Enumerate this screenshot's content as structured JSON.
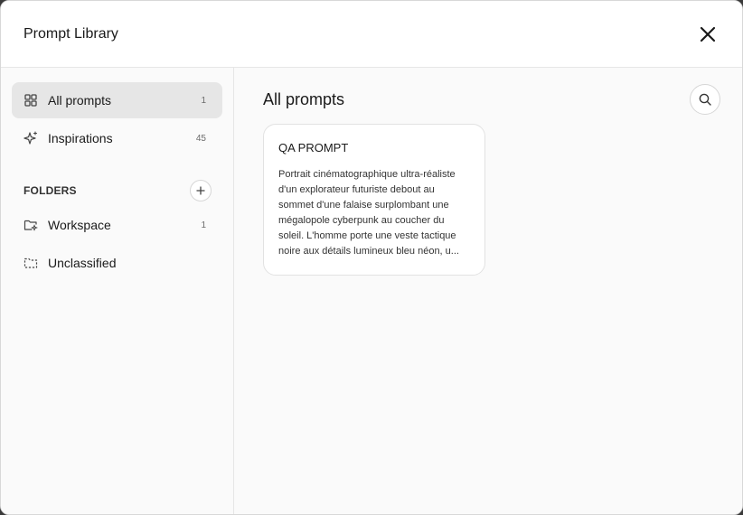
{
  "header": {
    "title": "Prompt Library"
  },
  "sidebar": {
    "items": [
      {
        "label": "All prompts",
        "count": "1",
        "icon": "grid-icon"
      },
      {
        "label": "Inspirations",
        "count": "45",
        "icon": "sparkle-icon"
      }
    ],
    "folders_title": "FOLDERS",
    "folders": [
      {
        "label": "Workspace",
        "count": "1",
        "icon": "folder-star-icon"
      },
      {
        "label": "Unclassified",
        "count": "",
        "icon": "dashed-folder-icon"
      }
    ]
  },
  "main": {
    "title": "All prompts",
    "cards": [
      {
        "title": "QA PROMPT",
        "text": "Portrait cinématographique ultra-réaliste d'un explorateur futuriste debout au sommet d'une falaise surplombant une mégalopole cyberpunk au coucher du soleil. L'homme porte une veste tactique noire aux détails lumineux bleu néon, u..."
      }
    ]
  }
}
